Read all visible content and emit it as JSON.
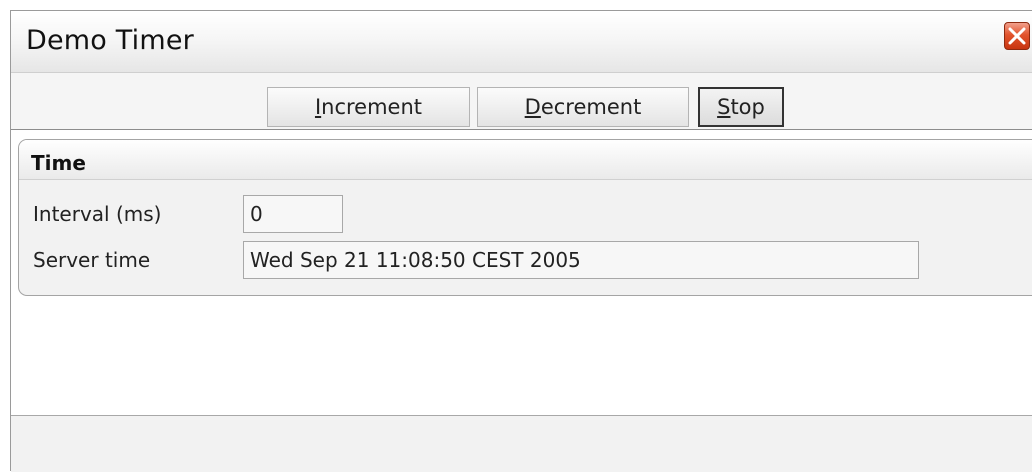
{
  "window": {
    "title": "Demo Timer"
  },
  "toolbar": {
    "increment": {
      "mnemonic": "I",
      "rest": "ncrement"
    },
    "decrement": {
      "mnemonic": "D",
      "rest": "ecrement"
    },
    "stop": {
      "mnemonic": "S",
      "rest": "top"
    }
  },
  "group": {
    "title": "Time",
    "interval_label": "Interval (ms)",
    "interval_value": "0",
    "server_time_label": "Server time",
    "server_time_value": "Wed Sep 21 11:08:50 CEST 2005"
  },
  "icons": {
    "close": "close-icon"
  },
  "colors": {
    "close_button": "#e2542d",
    "window_border": "#9a9a9a"
  }
}
